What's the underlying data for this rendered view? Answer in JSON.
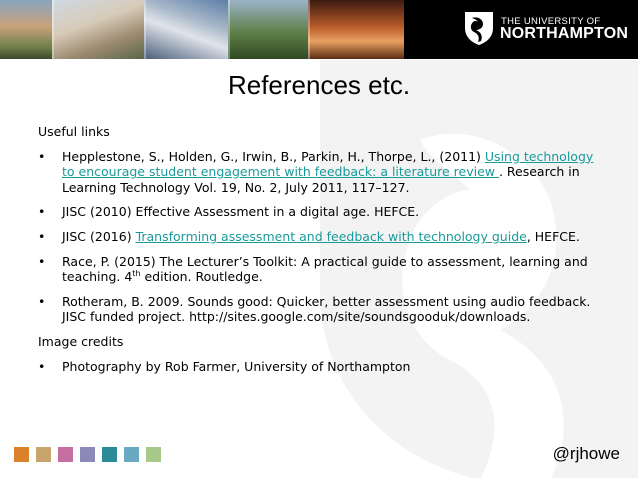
{
  "header": {
    "logo_top": "THE UNIVERSITY OF",
    "logo_main": "NORTHAMPTON"
  },
  "title": "References etc.",
  "sections": {
    "useful_links_heading": "Useful links",
    "image_credits_heading": "Image credits"
  },
  "references": {
    "hepplestone": {
      "prefix": "Hepplestone, S., Holden, G., Irwin, B., Parkin, H., Thorpe, L., (2011) ",
      "link": "Using technology to encourage student engagement with feedback: a literature review ",
      "suffix": ". Research in Learning Technology Vol. 19, No. 2, July 2011, 117–127."
    },
    "jisc_2010": {
      "text": "JISC (2010) Effective Assessment in a digital age. HEFCE."
    },
    "jisc_2016": {
      "prefix": "JISC (2016) ",
      "link": "Transforming assessment and feedback with technology guide",
      "suffix": ", HEFCE."
    },
    "race": {
      "prefix": "Race, P. (2015) The Lecturer’s Toolkit: A practical guide to assessment, learning and teaching. 4",
      "sup": "th",
      "suffix": " edition. Routledge."
    },
    "rotheram": {
      "text": "Rotheram, B. 2009. Sounds good: Quicker, better assessment using audio feedback. JISC funded project. http://sites.google.com/site/soundsgooduk/downloads."
    }
  },
  "credits": {
    "photography": "Photography by Rob Farmer, University of Northampton"
  },
  "bullet_glyph": "•",
  "footer": {
    "handle": "@rjhowe",
    "square_colors": [
      "#d9822b",
      "#c9a56e",
      "#c46fa0",
      "#8c88b8",
      "#2e8a99",
      "#6aa9c2",
      "#a9c98a"
    ]
  },
  "colors": {
    "link": "#1a9a9a",
    "header_bg": "#000000",
    "watermark": "#f2f2f2"
  }
}
